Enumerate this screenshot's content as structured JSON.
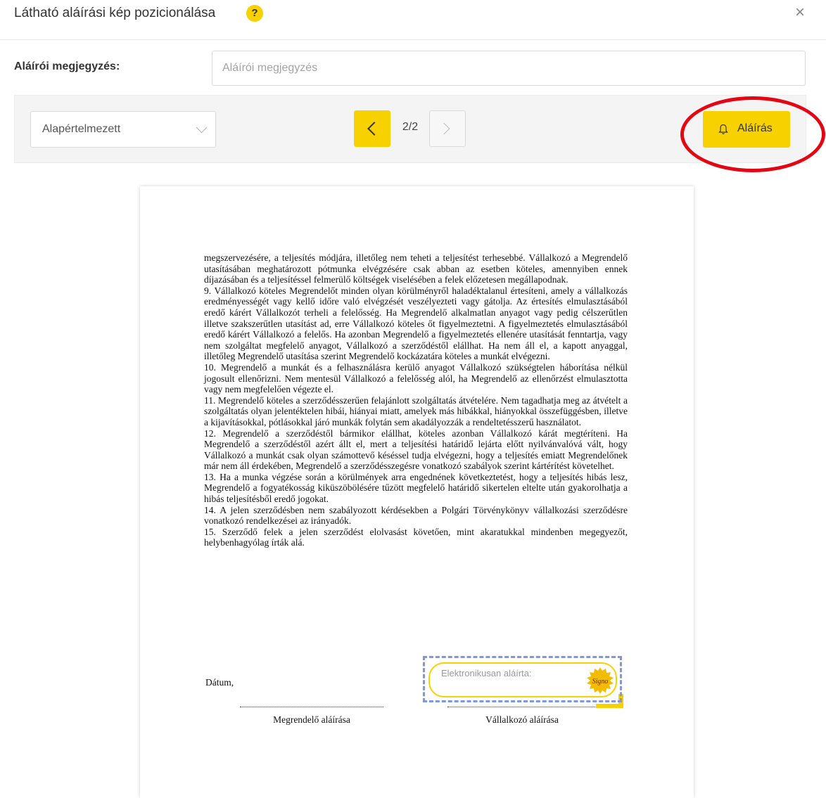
{
  "dialog": {
    "title": "Látható aláírási kép pozicionálása",
    "help_icon": "question-circle-icon",
    "help_text": "?",
    "close_icon": "close-icon",
    "close_text": "×"
  },
  "note": {
    "label": "Aláírói megjegyzés:",
    "placeholder": "Aláírói megjegyzés",
    "value": ""
  },
  "toolbar": {
    "select_value": "Alapértelmezett",
    "page_indicator": "2/2",
    "sign_label": "Aláírás",
    "sign_icon": "bell-icon"
  },
  "colors": {
    "accent": "#f7d100",
    "highlight": "#e30613",
    "dashed_border": "#7f97e3"
  },
  "document": {
    "paragraphs": [
      "megszervezésére, a teljesítés módjára, illetőleg nem teheti a teljesítést terhesebbé. Vállalkozó a Megrendelő utasításában meghatározott pótmunka elvégzésére csak abban az esetben köteles, amennyiben ennek díjazásában és a teljesítéssel felmerülő költségek viselésében a felek előzetesen megállapodnak.",
      "9. Vállalkozó köteles Megrendelőt minden olyan körülményről haladéktalanul értesíteni, amely a vállalkozás eredményességét vagy kellő időre való elvégzését veszélyezteti vagy gátolja. Az értesítés elmulasztásából eredő kárért Vállalkozót terheli a felelősség. Ha Megrendelő alkalmatlan anyagot vagy pedig célszerűtlen illetve szakszerűtlen utasítást ad, erre Vállalkozó köteles őt figyelmeztetni. A figyelmeztetés elmulasztásából eredő kárért Vállalkozó a felelős. Ha azonban Megrendelő a figyelmeztetés ellenére utasítását fenntartja, vagy nem szolgáltat megfelelő anyagot, Vállalkozó a szerződéstől elállhat. Ha nem áll el, a kapott anyaggal, illetőleg Megrendelő utasítása szerint Megrendelő kockázatára köteles a munkát elvégezni.",
      "10. Megrendelő a munkát és a felhasználásra kerülő anyagot Vállalkozó szükségtelen háborítása nélkül jogosult ellenőrizni. Nem mentesül Vállalkozó a felelősség alól, ha Megrendelő az ellenőrzést elmulasztotta vagy nem megfelelően végezte el.",
      "11. Megrendelő köteles a szerződésszerűen felajánlott szolgáltatás átvételére. Nem tagadhatja meg az átvételt a szolgáltatás olyan jelentéktelen hibái, hiányai miatt, amelyek más hibákkal, hiányokkal összefüggésben, illetve a kijavításokkal, pótlásokkal járó munkák folytán sem akadályozzák a rendeltetésszerű használatot.",
      "12. Megrendelő a szerződéstől bármikor elállhat, köteles azonban Vállalkozó kárát megtéríteni. Ha Megrendelő a szerződéstől azért állt el, mert a teljesítési határidő lejárta előtt nyilvánvalóvá vált, hogy Vállalkozó a munkát csak olyan számottevő késéssel tudja elvégezni, hogy a teljesítés emiatt Megrendelőnek már nem áll érdekében, Megrendelő a szerződésszegésre vonatkozó szabályok szerint kártérítést követelhet.",
      "13. Ha a munka végzése során a körülmények arra engednének következtetést, hogy a teljesítés hibás lesz, Megrendelő a fogyatékosság kiküszöbölésére tűzött megfelelő határidő sikertelen eltelte után gyakorolhatja a hibás teljesítésből eredő jogokat.",
      "14. A jelen szerződésben nem szabályozott kérdésekben a Polgári Törvénykönyv vállalkozási szerződésre vonatkozó rendelkezései az irányadók.",
      "15. Szerződő felek a jelen szerződést elolvasást követően, mint akaratukkal mindenben megegyezőt, helybenhagyólag írták alá."
    ],
    "date_label": "Dátum,",
    "left_signature_label": "Megrendelő aláírása",
    "right_signature_label": "Vállalkozó aláírása",
    "signature_box_text": "Elektronikusan aláírta:",
    "seal_text": "Signo",
    "seal_icon": "seal-badge-icon"
  }
}
